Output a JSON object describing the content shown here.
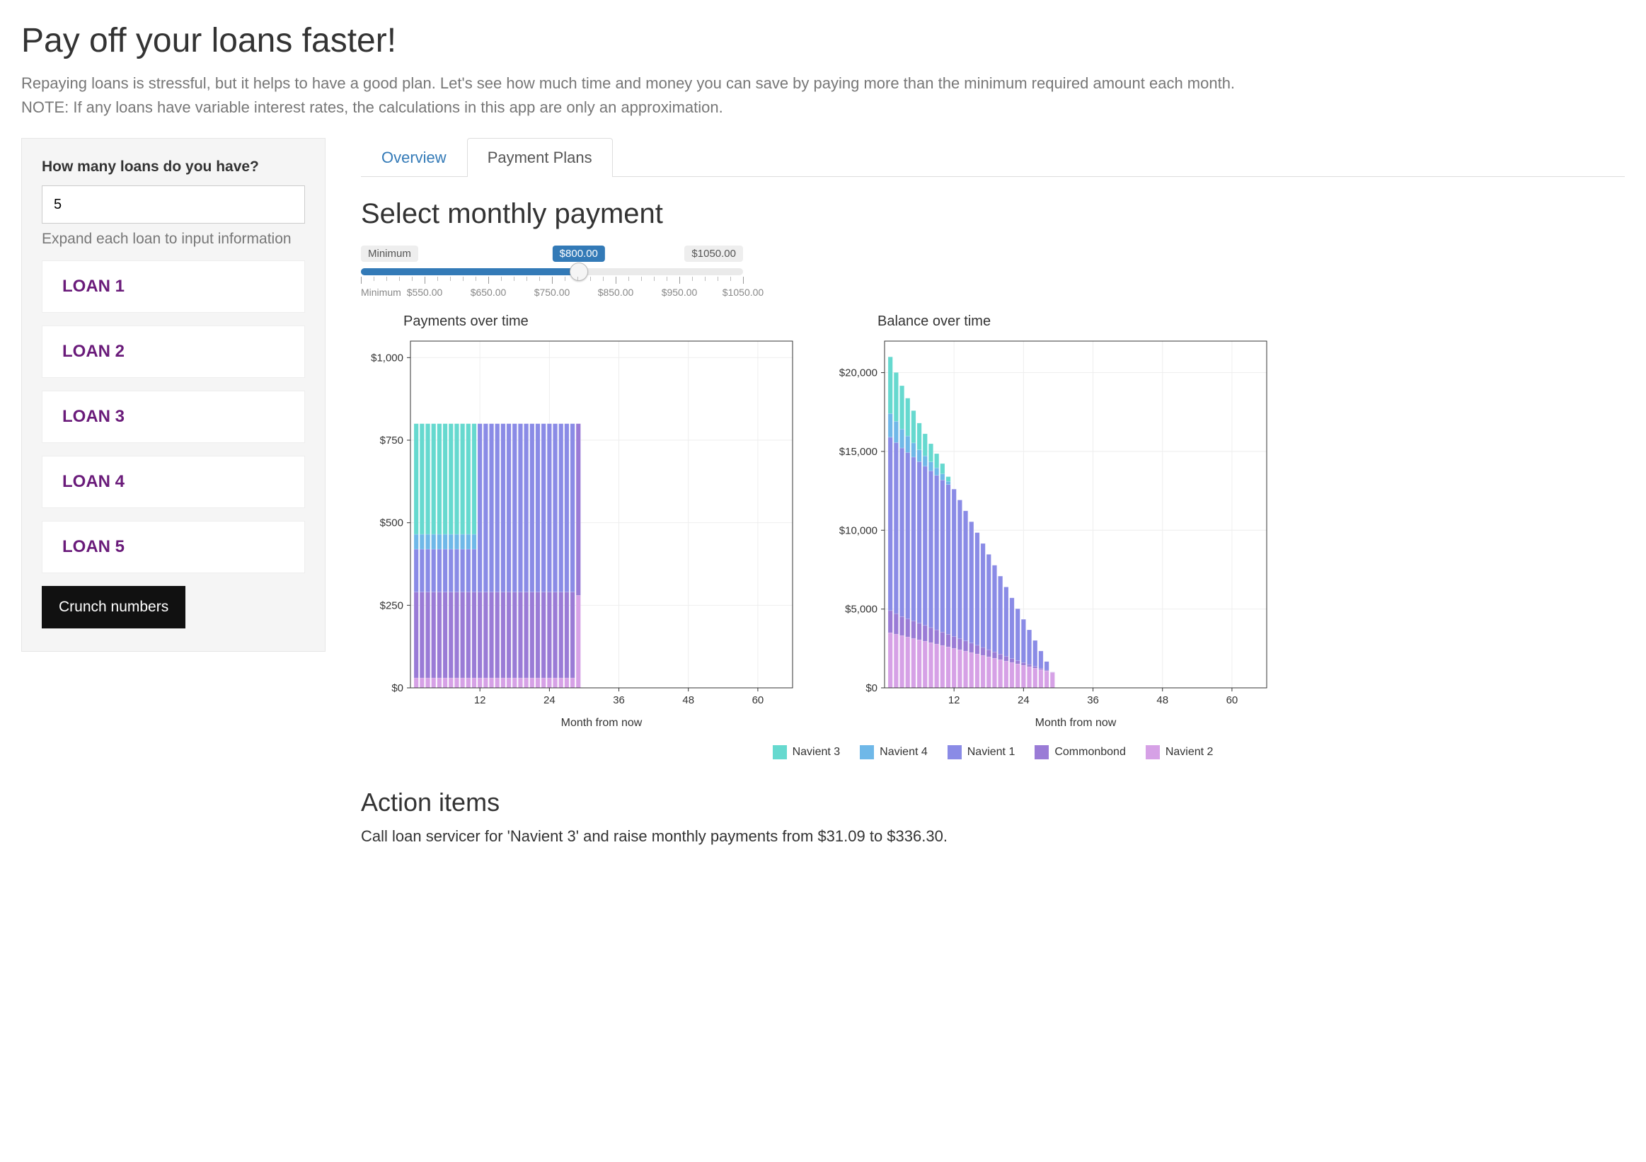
{
  "header": {
    "title": "Pay off your loans faster!",
    "lead": "Repaying loans is stressful, but it helps to have a good plan. Let's see how much time and money you can save by paying more than the minimum required amount each month.",
    "note": "NOTE: If any loans have variable interest rates, the calculations in this app are only an approximation."
  },
  "sidebar": {
    "question": "How many loans do you have?",
    "input_value": "5",
    "hint": "Expand each loan to input information",
    "loans": [
      "LOAN 1",
      "LOAN 2",
      "LOAN 3",
      "LOAN 4",
      "LOAN 5"
    ],
    "button": "Crunch numbers"
  },
  "tabs": {
    "overview": "Overview",
    "payment_plans": "Payment Plans",
    "active": "payment_plans"
  },
  "slider": {
    "title": "Select monthly payment",
    "min_label": "Minimum",
    "value_label": "$800.00",
    "max_label": "$1050.00",
    "percent": 57,
    "tick_labels": [
      "Minimum",
      "$550.00",
      "$650.00",
      "$750.00",
      "$850.00",
      "$950.00",
      "$1050.00"
    ]
  },
  "legend": [
    {
      "name": "Navient 3",
      "color": "#66d9cf"
    },
    {
      "name": "Navient 4",
      "color": "#6fb8e8"
    },
    {
      "name": "Navient 1",
      "color": "#8a8be6"
    },
    {
      "name": "Commonbond",
      "color": "#9a7bd6"
    },
    {
      "name": "Navient 2",
      "color": "#d6a1e6"
    }
  ],
  "charts": {
    "payments_title": "Payments over time",
    "balance_title": "Balance over time",
    "xlabel": "Month from now"
  },
  "actions": {
    "title": "Action items",
    "item1": "Call loan servicer for 'Navient 3' and raise monthly payments from $31.09 to $336.30."
  },
  "chart_data": [
    {
      "type": "bar",
      "stacked": true,
      "title": "Payments over time",
      "xlabel": "Month from now",
      "ylabel": "",
      "xlim": [
        0,
        66
      ],
      "ylim": [
        0,
        1050
      ],
      "x_ticks": [
        12,
        24,
        36,
        48,
        60
      ],
      "y_ticks": [
        0,
        250,
        500,
        750,
        1000
      ],
      "y_tick_labels": [
        "$0",
        "$250",
        "$500",
        "$750",
        "$1,000"
      ],
      "series": [
        {
          "name": "Navient 2",
          "color": "#d6a1e6",
          "values": [
            30,
            30,
            30,
            30,
            30,
            30,
            30,
            30,
            30,
            30,
            30,
            30,
            30,
            30,
            30,
            30,
            30,
            30,
            30,
            30,
            30,
            30,
            30,
            30,
            30,
            30,
            30,
            30,
            280,
            0,
            0,
            0,
            0,
            0,
            0,
            0,
            0,
            0,
            0,
            0,
            0,
            0,
            0,
            0,
            0,
            0,
            0,
            0,
            0,
            0,
            0,
            0,
            0,
            0,
            0,
            0,
            0,
            0,
            0,
            0,
            0,
            0,
            0,
            0,
            0,
            0
          ]
        },
        {
          "name": "Commonbond",
          "color": "#9a7bd6",
          "values": [
            260,
            260,
            260,
            260,
            260,
            260,
            260,
            260,
            260,
            260,
            260,
            260,
            260,
            260,
            260,
            260,
            260,
            260,
            260,
            260,
            260,
            260,
            260,
            260,
            260,
            260,
            260,
            260,
            520,
            0,
            0,
            0,
            0,
            0,
            0,
            0,
            0,
            0,
            0,
            0,
            0,
            0,
            0,
            0,
            0,
            0,
            0,
            0,
            0,
            0,
            0,
            0,
            0,
            0,
            0,
            0,
            0,
            0,
            0,
            0,
            0,
            0,
            0,
            0,
            0,
            0
          ]
        },
        {
          "name": "Navient 1",
          "color": "#8a8be6",
          "values": [
            130,
            130,
            130,
            130,
            130,
            130,
            130,
            130,
            130,
            130,
            130,
            510,
            510,
            510,
            510,
            510,
            510,
            510,
            510,
            510,
            510,
            510,
            510,
            510,
            510,
            510,
            510,
            510,
            0,
            0,
            0,
            0,
            0,
            0,
            0,
            0,
            0,
            0,
            0,
            0,
            0,
            0,
            0,
            0,
            0,
            0,
            0,
            0,
            0,
            0,
            0,
            0,
            0,
            0,
            0,
            0,
            0,
            0,
            0,
            0,
            0,
            0,
            0,
            0,
            0,
            0
          ]
        },
        {
          "name": "Navient 4",
          "color": "#6fb8e8",
          "values": [
            45,
            45,
            45,
            45,
            45,
            45,
            45,
            45,
            45,
            45,
            45,
            0,
            0,
            0,
            0,
            0,
            0,
            0,
            0,
            0,
            0,
            0,
            0,
            0,
            0,
            0,
            0,
            0,
            0,
            0,
            0,
            0,
            0,
            0,
            0,
            0,
            0,
            0,
            0,
            0,
            0,
            0,
            0,
            0,
            0,
            0,
            0,
            0,
            0,
            0,
            0,
            0,
            0,
            0,
            0,
            0,
            0,
            0,
            0,
            0,
            0,
            0,
            0,
            0,
            0,
            0
          ]
        },
        {
          "name": "Navient 3",
          "color": "#66d9cf",
          "values": [
            335,
            335,
            335,
            335,
            335,
            335,
            335,
            335,
            335,
            335,
            335,
            0,
            0,
            0,
            0,
            0,
            0,
            0,
            0,
            0,
            0,
            0,
            0,
            0,
            0,
            0,
            0,
            0,
            0,
            0,
            0,
            0,
            0,
            0,
            0,
            0,
            0,
            0,
            0,
            0,
            0,
            0,
            0,
            0,
            0,
            0,
            0,
            0,
            0,
            0,
            0,
            0,
            0,
            0,
            0,
            0,
            0,
            0,
            0,
            0,
            0,
            0,
            0,
            0,
            0,
            0
          ]
        }
      ]
    },
    {
      "type": "bar",
      "stacked": true,
      "title": "Balance over time",
      "xlabel": "Month from now",
      "ylabel": "",
      "xlim": [
        0,
        66
      ],
      "ylim": [
        0,
        22000
      ],
      "x_ticks": [
        12,
        24,
        36,
        48,
        60
      ],
      "y_ticks": [
        0,
        5000,
        10000,
        15000,
        20000
      ],
      "y_tick_labels": [
        "$0",
        "$5,000",
        "$10,000",
        "$15,000",
        "$20,000"
      ],
      "series": [
        {
          "name": "Navient 2",
          "color": "#d6a1e6",
          "values": [
            3500,
            3410,
            3320,
            3230,
            3140,
            3050,
            2960,
            2870,
            2780,
            2690,
            2600,
            2510,
            2420,
            2330,
            2240,
            2150,
            2060,
            1970,
            1880,
            1790,
            1700,
            1610,
            1520,
            1430,
            1340,
            1250,
            1160,
            1070,
            980,
            0,
            0,
            0,
            0,
            0,
            0,
            0,
            0,
            0,
            0,
            0,
            0,
            0,
            0,
            0,
            0,
            0,
            0,
            0,
            0,
            0,
            0,
            0,
            0,
            0,
            0,
            0,
            0,
            0,
            0,
            0,
            0,
            0,
            0,
            0,
            0,
            0
          ]
        },
        {
          "name": "Commonbond",
          "color": "#9a7bd6",
          "values": [
            1400,
            1300,
            1200,
            1150,
            1100,
            1050,
            1000,
            950,
            900,
            850,
            800,
            750,
            700,
            650,
            600,
            550,
            500,
            450,
            400,
            350,
            300,
            250,
            200,
            170,
            140,
            110,
            80,
            50,
            20,
            0,
            0,
            0,
            0,
            0,
            0,
            0,
            0,
            0,
            0,
            0,
            0,
            0,
            0,
            0,
            0,
            0,
            0,
            0,
            0,
            0,
            0,
            0,
            0,
            0,
            0,
            0,
            0,
            0,
            0,
            0,
            0,
            0,
            0,
            0,
            0,
            0
          ]
        },
        {
          "name": "Navient 1",
          "color": "#8a8be6",
          "values": [
            11000,
            10850,
            10700,
            10550,
            10400,
            10250,
            10100,
            9950,
            9800,
            9650,
            9500,
            9350,
            8800,
            8250,
            7700,
            7150,
            6600,
            6050,
            5500,
            4950,
            4400,
            3850,
            3300,
            2750,
            2200,
            1650,
            1100,
            550,
            0,
            0,
            0,
            0,
            0,
            0,
            0,
            0,
            0,
            0,
            0,
            0,
            0,
            0,
            0,
            0,
            0,
            0,
            0,
            0,
            0,
            0,
            0,
            0,
            0,
            0,
            0,
            0,
            0,
            0,
            0,
            0,
            0,
            0,
            0,
            0,
            0,
            0
          ]
        },
        {
          "name": "Navient 4",
          "color": "#6fb8e8",
          "values": [
            1500,
            1350,
            1200,
            1050,
            900,
            750,
            660,
            570,
            480,
            390,
            200,
            0,
            0,
            0,
            0,
            0,
            0,
            0,
            0,
            0,
            0,
            0,
            0,
            0,
            0,
            0,
            0,
            0,
            0,
            0,
            0,
            0,
            0,
            0,
            0,
            0,
            0,
            0,
            0,
            0,
            0,
            0,
            0,
            0,
            0,
            0,
            0,
            0,
            0,
            0,
            0,
            0,
            0,
            0,
            0,
            0,
            0,
            0,
            0,
            0,
            0,
            0,
            0,
            0,
            0,
            0
          ]
        },
        {
          "name": "Navient 3",
          "color": "#66d9cf",
          "values": [
            3600,
            3100,
            2750,
            2400,
            2050,
            1700,
            1400,
            1150,
            900,
            650,
            300,
            0,
            0,
            0,
            0,
            0,
            0,
            0,
            0,
            0,
            0,
            0,
            0,
            0,
            0,
            0,
            0,
            0,
            0,
            0,
            0,
            0,
            0,
            0,
            0,
            0,
            0,
            0,
            0,
            0,
            0,
            0,
            0,
            0,
            0,
            0,
            0,
            0,
            0,
            0,
            0,
            0,
            0,
            0,
            0,
            0,
            0,
            0,
            0,
            0,
            0,
            0,
            0,
            0,
            0,
            0
          ]
        }
      ]
    }
  ]
}
